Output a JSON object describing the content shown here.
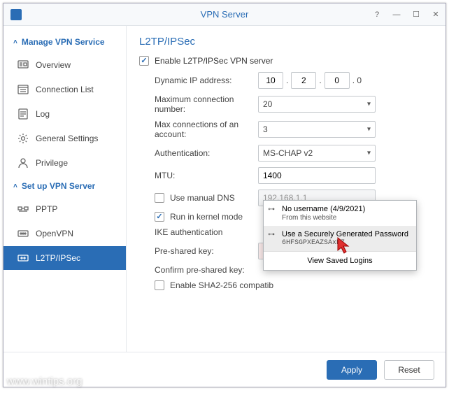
{
  "window": {
    "title": "VPN Server"
  },
  "sidebar": {
    "section1": "Manage VPN Service",
    "section2": "Set up VPN Server",
    "items1": [
      {
        "label": "Overview"
      },
      {
        "label": "Connection List"
      },
      {
        "label": "Log"
      },
      {
        "label": "General Settings"
      },
      {
        "label": "Privilege"
      }
    ],
    "items2": [
      {
        "label": "PPTP"
      },
      {
        "label": "OpenVPN"
      },
      {
        "label": "L2TP/IPSec"
      }
    ]
  },
  "page": {
    "title": "L2TP/IPSec",
    "enable_label": "Enable L2TP/IPSec VPN server",
    "dynamic_ip_label": "Dynamic IP address:",
    "ip": {
      "a": "10",
      "b": "2",
      "c": "0",
      "d": "0"
    },
    "max_conn_label": "Maximum connection number:",
    "max_conn_value": "20",
    "max_acct_label": "Max connections of an account:",
    "max_acct_value": "3",
    "auth_label": "Authentication:",
    "auth_value": "MS-CHAP v2",
    "mtu_label": "MTU:",
    "mtu_value": "1400",
    "manual_dns_label": "Use manual DNS",
    "manual_dns_value": "192.168.1.1",
    "kernel_mode_label": "Run in kernel mode",
    "ike_label": "IKE authentication",
    "psk_label": "Pre-shared key:",
    "psk_confirm_label": "Confirm pre-shared key:",
    "sha_label": "Enable SHA2-256 compatib"
  },
  "popup": {
    "items": [
      {
        "main": "No username (4/9/2021)",
        "sub": "From this website"
      },
      {
        "main": "Use a Securely Generated Password",
        "sub": "6HFSGPXEAZSAxB7"
      }
    ],
    "footer": "View Saved Logins"
  },
  "footer": {
    "apply": "Apply",
    "reset": "Reset"
  },
  "watermark": "www.wintips.org"
}
